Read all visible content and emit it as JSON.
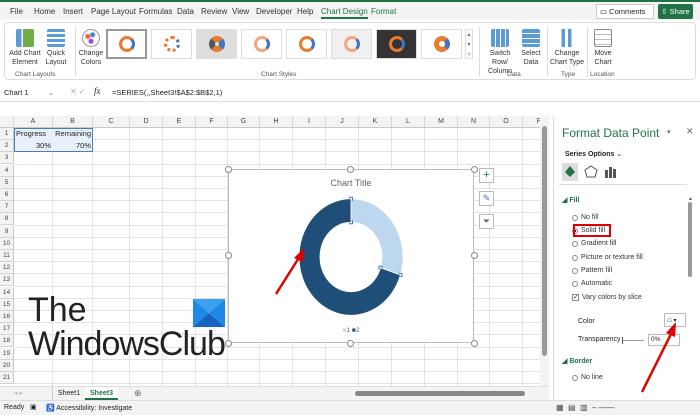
{
  "menu": {
    "tabs": [
      "File",
      "Home",
      "Insert",
      "Page Layout",
      "Formulas",
      "Data",
      "Review",
      "View",
      "Developer",
      "Help",
      "Chart Design",
      "Format"
    ],
    "active": "Chart Design",
    "comments": "Comments",
    "share": "Share"
  },
  "ribbon": {
    "add_chart": "Add Chart",
    "add_chart2": "Element",
    "quick": "Quick",
    "quick2": "Layout",
    "group_layouts": "Chart Layouts",
    "change_colors": "Change",
    "change_colors2": "Colors",
    "group_styles": "Chart Styles",
    "switch": "Switch Row/",
    "switch2": "Column",
    "select": "Select",
    "select2": "Data",
    "group_data": "Data",
    "change_type": "Change",
    "change_type2": "Chart Type",
    "group_type": "Type",
    "move": "Move",
    "move2": "Chart",
    "group_location": "Location"
  },
  "formula_bar": {
    "name_box": "Chart 1",
    "fx": "fx",
    "formula": "=SERIES(,,Sheet3!$A$2:$B$2,1)"
  },
  "sheet": {
    "columns": [
      "A",
      "B",
      "C",
      "D",
      "E",
      "F",
      "G",
      "H",
      "I",
      "J",
      "K",
      "L",
      "M",
      "N",
      "O",
      "P"
    ],
    "rows": [
      "1",
      "2",
      "3",
      "4",
      "5",
      "6",
      "7",
      "8",
      "9",
      "10",
      "11",
      "12",
      "13",
      "14",
      "15",
      "16",
      "17",
      "18",
      "19",
      "20",
      "21"
    ],
    "cells": {
      "A1": "Progress",
      "B1": "Remaining",
      "A2": "30%",
      "B2": "70%"
    }
  },
  "chart_data": {
    "type": "pie",
    "subtype": "doughnut",
    "title": "Chart Title",
    "categories": [
      "1",
      "2"
    ],
    "values": [
      30,
      70
    ],
    "colors": [
      "#bdd7ee",
      "#1f4e79"
    ],
    "legend": "bottom"
  },
  "watermark": {
    "line1": "The",
    "line2": "WindowsClub"
  },
  "sheet_tabs": [
    "Sheet1",
    "Sheet3"
  ],
  "active_sheet": "Sheet3",
  "status": {
    "ready": "Ready",
    "accessibility": "Accessibility: Investigate"
  },
  "panel": {
    "title": "Format Data Point",
    "series_options": "Series Options",
    "fill_header": "Fill",
    "fill_options": [
      "No fill",
      "Solid fill",
      "Gradient fill",
      "Picture or texture fill",
      "Pattern fill",
      "Automatic"
    ],
    "selected_fill": "Solid fill",
    "vary": "Vary colors by slice",
    "color_label": "Color",
    "transparency_label": "Transparency",
    "transparency_value": "0%",
    "border_header": "Border",
    "border_options": [
      "No line"
    ]
  },
  "colors": {
    "accent": "#217346",
    "highlight": "#e00000"
  }
}
